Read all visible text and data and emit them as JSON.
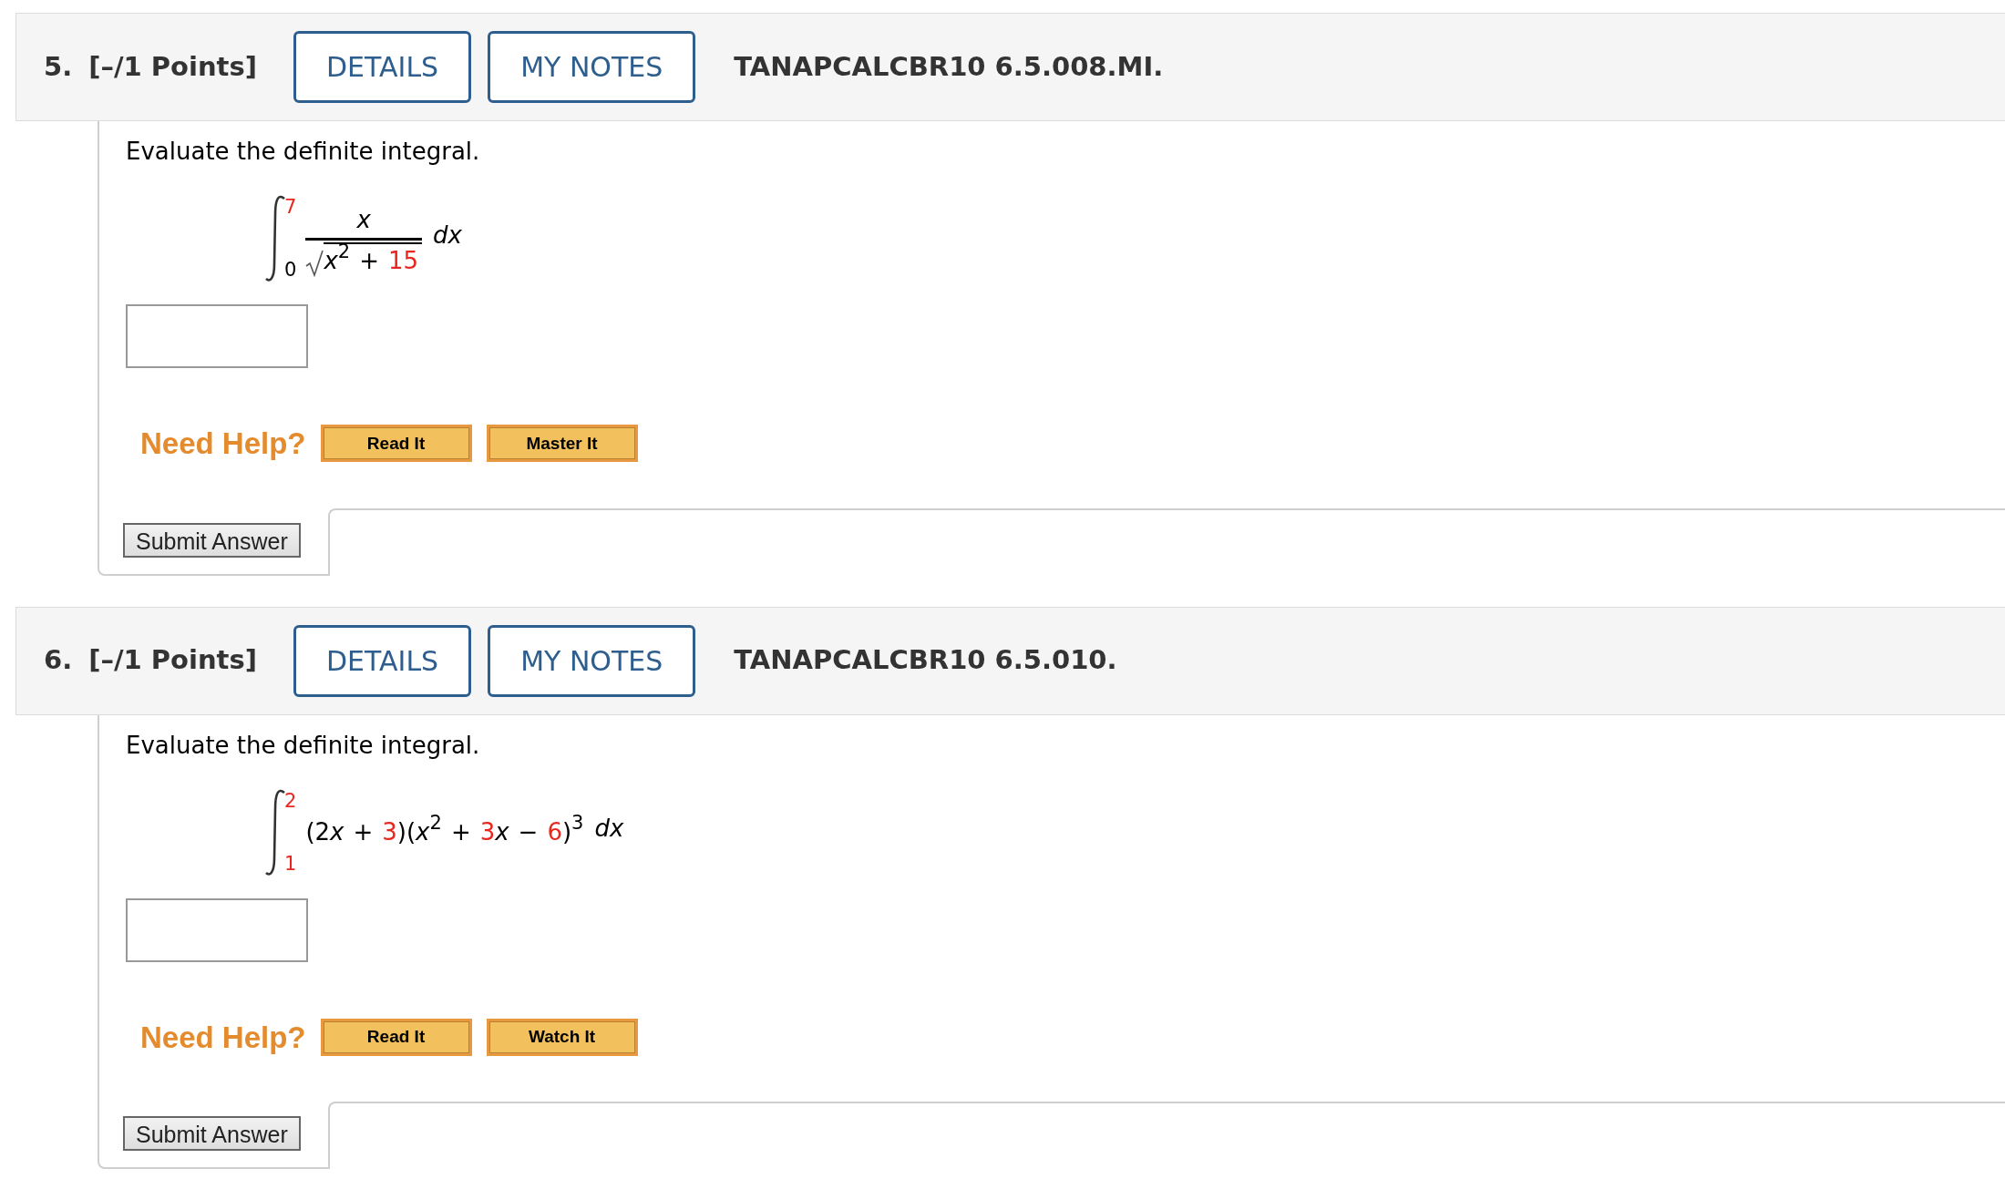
{
  "questions": [
    {
      "number": "5.",
      "points": "[–/1 Points]",
      "buttons": [
        "DETAILS",
        "MY NOTES"
      ],
      "code": "TANAPCALCBR10 6.5.008.MI.",
      "prompt": "Evaluate the definite integral.",
      "integral": {
        "upper": {
          "text": "7",
          "highlighted": true
        },
        "lower": {
          "text": "0",
          "highlighted": false
        },
        "integrand": {
          "kind": "fraction",
          "numerator": [
            {
              "kind": "var",
              "text": "x",
              "highlighted": false
            }
          ],
          "denominator": [
            {
              "kind": "var",
              "text": "x",
              "highlighted": false
            },
            {
              "kind": "sup",
              "text": "2",
              "highlighted": false
            },
            {
              "kind": "binop",
              "text": "+",
              "highlighted": false
            },
            {
              "kind": "num",
              "text": "15",
              "highlighted": true
            }
          ]
        },
        "differential": "dx"
      },
      "help_label": "Need Help?",
      "help_buttons": [
        "Read It",
        "Master It"
      ],
      "submit": "Submit Answer"
    },
    {
      "number": "6.",
      "points": "[–/1 Points]",
      "buttons": [
        "DETAILS",
        "MY NOTES"
      ],
      "code": "TANAPCALCBR10 6.5.010.",
      "prompt": "Evaluate the definite integral.",
      "integral": {
        "upper": {
          "text": "2",
          "highlighted": true
        },
        "lower": {
          "text": "1",
          "highlighted": true
        },
        "integrand": {
          "kind": "product",
          "tokens": [
            {
              "kind": "paren",
              "text": "(",
              "highlighted": false
            },
            {
              "kind": "num",
              "text": "2",
              "highlighted": false
            },
            {
              "kind": "var",
              "text": "x",
              "highlighted": false
            },
            {
              "kind": "binop",
              "text": "+",
              "highlighted": false
            },
            {
              "kind": "num",
              "text": "3",
              "highlighted": true
            },
            {
              "kind": "paren",
              "text": ")(",
              "highlighted": false
            },
            {
              "kind": "var",
              "text": "x",
              "highlighted": false
            },
            {
              "kind": "sup",
              "text": "2",
              "highlighted": false
            },
            {
              "kind": "binop",
              "text": "+",
              "highlighted": false
            },
            {
              "kind": "num",
              "text": "3",
              "highlighted": true
            },
            {
              "kind": "var",
              "text": "x",
              "highlighted": false
            },
            {
              "kind": "binop",
              "text": "−",
              "highlighted": false
            },
            {
              "kind": "num",
              "text": "6",
              "highlighted": true
            },
            {
              "kind": "paren",
              "text": ")",
              "highlighted": false
            },
            {
              "kind": "sup",
              "text": "3",
              "highlighted": false
            }
          ]
        },
        "differential": "dx"
      },
      "help_label": "Need Help?",
      "help_buttons": [
        "Read It",
        "Watch It"
      ],
      "submit": "Submit Answer"
    }
  ]
}
